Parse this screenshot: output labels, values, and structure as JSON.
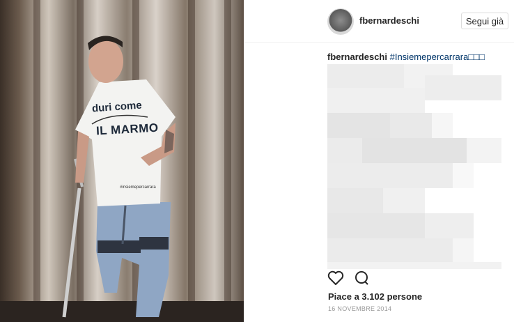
{
  "post": {
    "username": "fbernardeschi",
    "follow_label": "Segui già",
    "caption_username": "fbernardeschi",
    "caption_hashtag": "#Insiemepercarrara",
    "caption_emoji": "□□□",
    "likes_text": "Piace a 3.102 persone",
    "date_text": "16 NOVEMBRE 2014"
  },
  "photo": {
    "shirt_line1": "duri come",
    "shirt_line2": "IL MARMO",
    "shirt_hashtag": "#insiemepercarrara"
  },
  "icons": {
    "like": "heart-outline-icon",
    "comment": "speech-bubble-icon"
  },
  "colors": {
    "hashtag": "#003569",
    "text": "#262626",
    "muted": "#999999",
    "border": "#dbdbdb"
  }
}
